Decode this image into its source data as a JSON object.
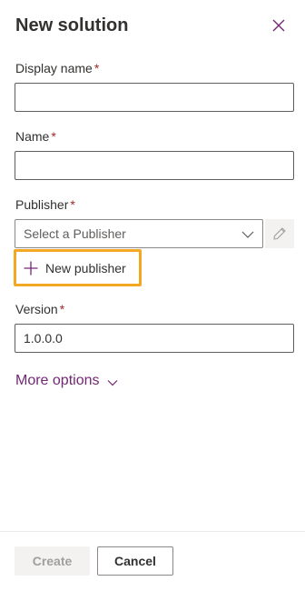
{
  "panel": {
    "title": "New solution",
    "close_icon": "close-icon"
  },
  "form": {
    "display_name": {
      "label": "Display name",
      "required_mark": "*",
      "value": ""
    },
    "name": {
      "label": "Name",
      "required_mark": "*",
      "value": ""
    },
    "publisher": {
      "label": "Publisher",
      "required_mark": "*",
      "placeholder": "Select a Publisher",
      "dropdown_icon": "chevron-down-icon",
      "edit_icon": "pencil-icon",
      "new_publisher_label": "New publisher",
      "new_publisher_icon": "plus-icon"
    },
    "version": {
      "label": "Version",
      "required_mark": "*",
      "value": "1.0.0.0"
    },
    "more_options": {
      "label": "More options",
      "icon": "chevron-down-icon"
    }
  },
  "footer": {
    "create_label": "Create",
    "cancel_label": "Cancel"
  },
  "colors": {
    "accent_purple": "#742774",
    "required_red": "#a4262c",
    "highlight_orange": "#f4a723"
  }
}
